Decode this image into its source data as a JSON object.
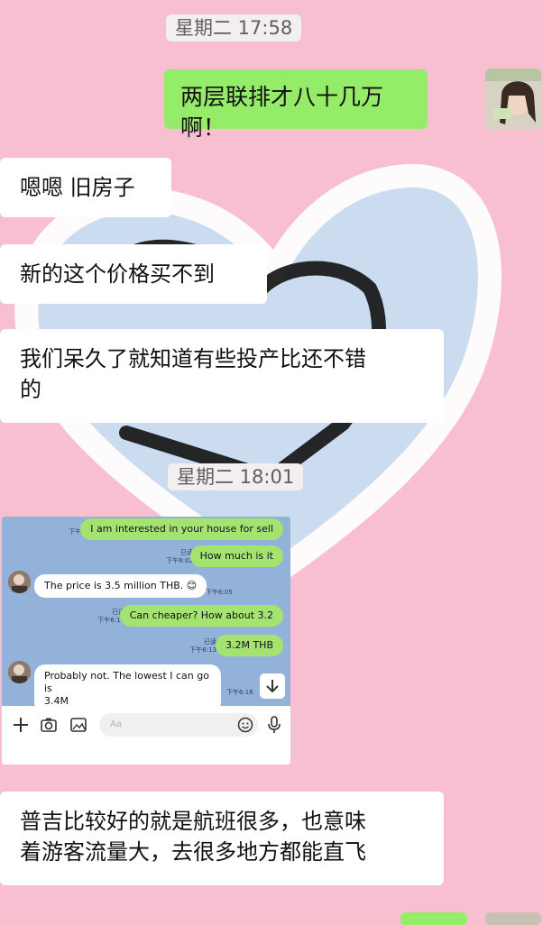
{
  "timestamps": [
    "星期二 17:58",
    "星期二 18:01"
  ],
  "messages": {
    "out1": "两层联排才八十几万啊！",
    "in1": "嗯嗯 旧房子",
    "in2": "新的这个价格买不到",
    "in3_line1": "我们呆久了就知道有些投产比还不错",
    "in3_line2": "的",
    "in4_line1": "普吉比较好的就是航班很多，也意味",
    "in4_line2": "着游客流量大，去很多地方都能直飞"
  },
  "line_chat": {
    "messages": [
      {
        "dir": "out",
        "text": "I am interested in your house for sell",
        "read": "已读",
        "time": "下午6:02"
      },
      {
        "dir": "out",
        "text": "How much is it",
        "read": "已读",
        "time": "下午6:02"
      },
      {
        "dir": "in",
        "text": "The price is 3.5 million THB. 😊",
        "time": "下午6:05"
      },
      {
        "dir": "out",
        "text": "Can cheaper? How about 3.2",
        "read": "已读",
        "time": "下午6:11"
      },
      {
        "dir": "out",
        "text": "3.2M THB",
        "read": "已读",
        "time": "下午6:13"
      },
      {
        "dir": "in",
        "text_line1": "Probably not. The lowest I can go is",
        "text_line2": "3.4M",
        "time": "下午6:16"
      }
    ],
    "input_placeholder": "Aa",
    "icons": [
      "plus-icon",
      "camera-icon",
      "image-icon",
      "emoji-icon",
      "microphone-icon",
      "arrow-down-icon"
    ]
  },
  "colors": {
    "background": "#f7bfd0",
    "outgoing_bubble": "#95ec69",
    "incoming_bubble": "#ffffff",
    "line_background": "#93b2d9",
    "line_outgoing": "#a4e36f"
  }
}
